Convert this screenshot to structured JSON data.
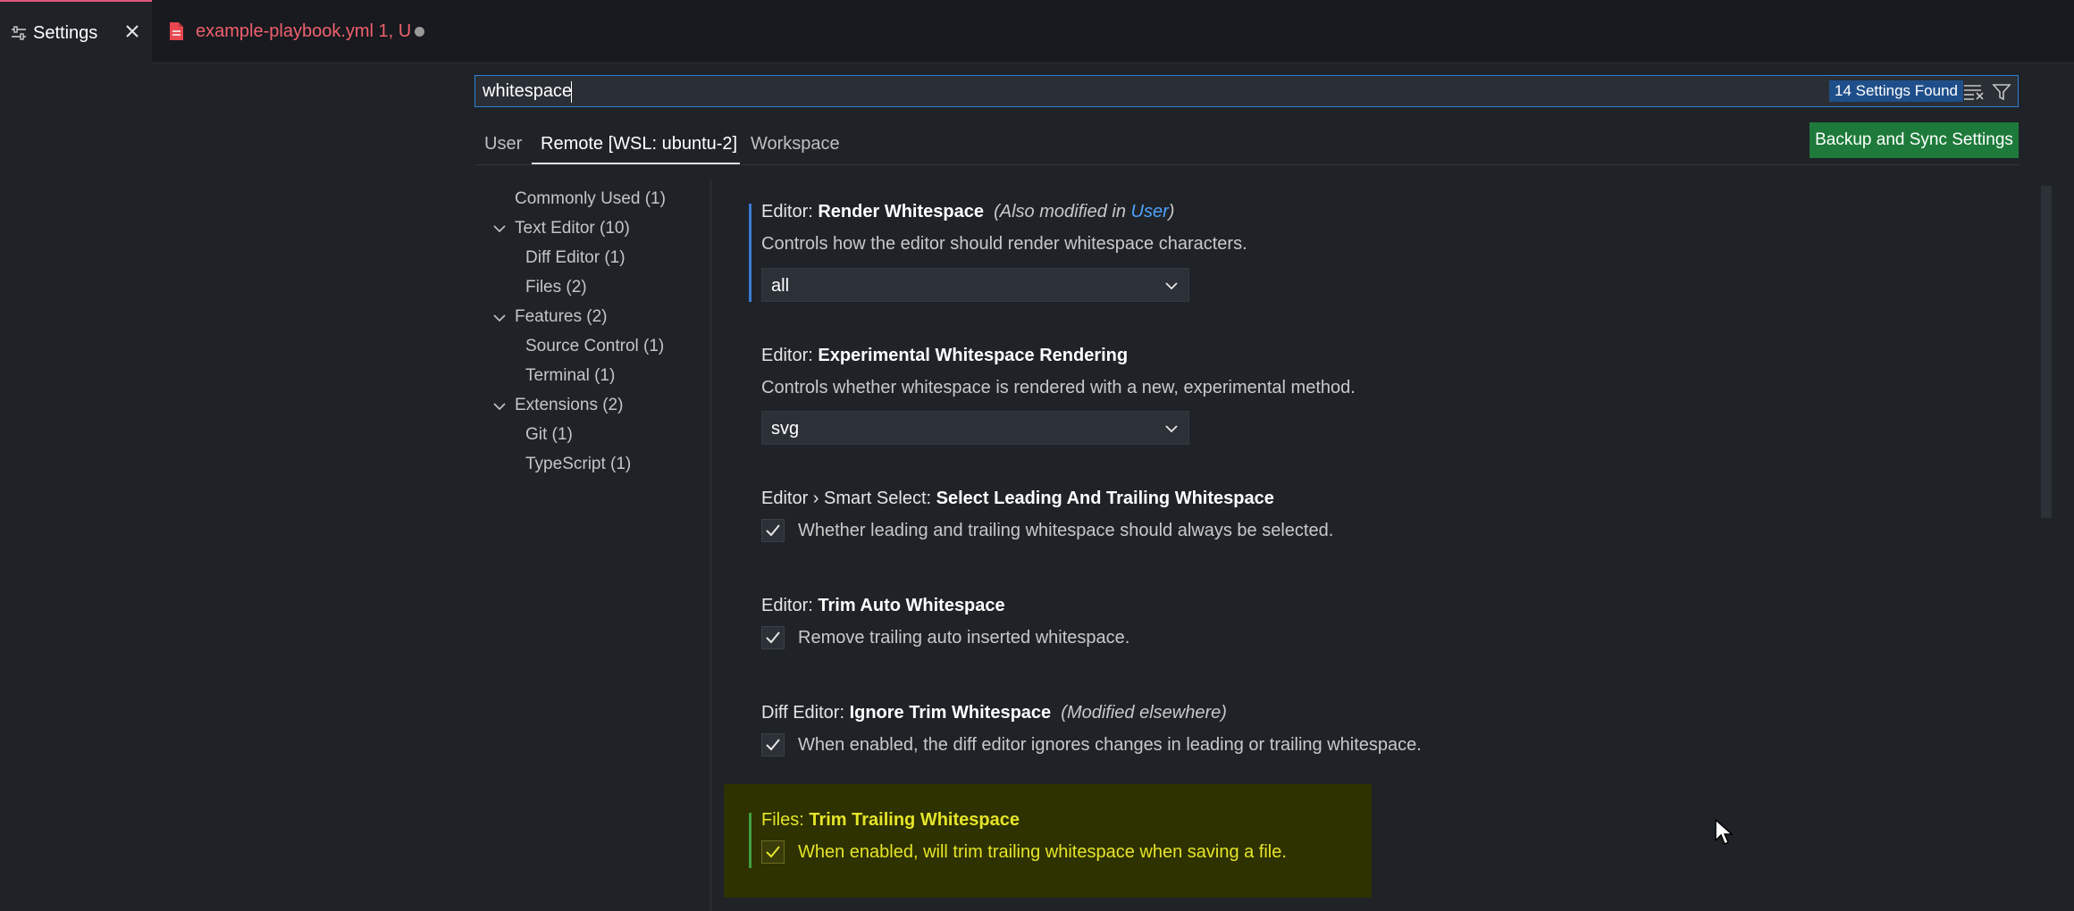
{
  "tabs": [
    {
      "label": "Settings",
      "icon": "settings-sliders-icon",
      "active": true
    },
    {
      "label": "example-playbook.yml 1, U",
      "icon": "yaml-file-icon",
      "color": "#f0616e",
      "dirty": true
    }
  ],
  "search": {
    "value": "whitespace",
    "result_count": "14 Settings Found"
  },
  "scopes": {
    "user": "User",
    "remote": "Remote [WSL: ubuntu-2]",
    "workspace": "Workspace",
    "active": "remote"
  },
  "sync_button": "Backup and Sync Settings",
  "toc": {
    "commonly_used": "Commonly Used (1)",
    "text_editor": "Text Editor (10)",
    "diff_editor": "Diff Editor (1)",
    "files": "Files (2)",
    "features": "Features (2)",
    "source_control": "Source Control (1)",
    "terminal": "Terminal (1)",
    "extensions": "Extensions (2)",
    "git": "Git (1)",
    "typescript": "TypeScript (1)"
  },
  "settings": {
    "render_ws": {
      "category": "Editor: ",
      "name": "Render Whitespace",
      "modified_prefix": "(Also modified in ",
      "modified_link": "User",
      "modified_suffix": ")",
      "description": "Controls how the editor should render whitespace characters.",
      "value": "all"
    },
    "exp_ws": {
      "category": "Editor: ",
      "name": "Experimental Whitespace Rendering",
      "description": "Controls whether whitespace is rendered with a new, experimental method.",
      "value": "svg"
    },
    "smart_select": {
      "category": "Editor › Smart Select: ",
      "name": "Select Leading And Trailing Whitespace",
      "description": "Whether leading and trailing whitespace should always be selected.",
      "checked": true
    },
    "trim_auto": {
      "category": "Editor: ",
      "name": "Trim Auto Whitespace",
      "description": "Remove trailing auto inserted whitespace.",
      "checked": true
    },
    "diff_trim": {
      "category": "Diff Editor: ",
      "name": "Ignore Trim Whitespace",
      "modified_note": "(Modified elsewhere)",
      "description": "When enabled, the diff editor ignores changes in leading or trailing whitespace.",
      "checked": true
    },
    "files_trim": {
      "category": "Files: ",
      "name": "Trim Trailing Whitespace",
      "description": "When enabled, will trim trailing whitespace when saving a file.",
      "checked": true,
      "highlighted": true
    }
  },
  "colors": {
    "accent": "#2f80d6",
    "sync_button": "#1d7a3a",
    "highlight_bg": "#2e3100",
    "highlight_text": "#e5e52a",
    "file_tab": "#f0616e"
  }
}
